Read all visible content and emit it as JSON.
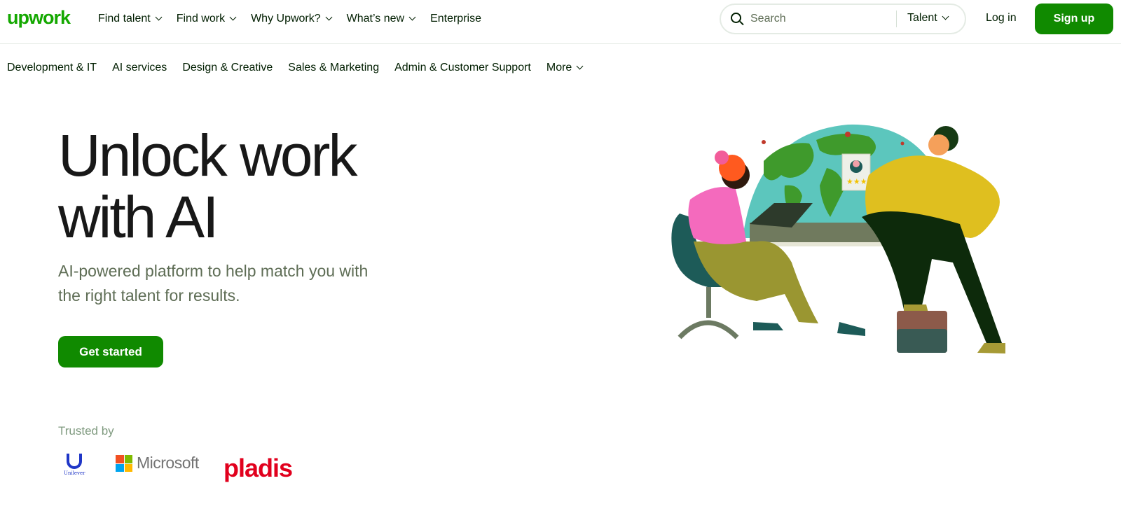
{
  "header": {
    "logo": "upwork",
    "nav": [
      {
        "label": "Find talent",
        "dropdown": true
      },
      {
        "label": "Find work",
        "dropdown": true
      },
      {
        "label": "Why Upwork?",
        "dropdown": true
      },
      {
        "label": "What’s new",
        "dropdown": true
      },
      {
        "label": "Enterprise",
        "dropdown": false
      }
    ],
    "search": {
      "placeholder": "Search",
      "scope": "Talent"
    },
    "login": "Log in",
    "signup": "Sign up"
  },
  "categories": [
    "Development & IT",
    "AI services",
    "Design & Creative",
    "Sales & Marketing",
    "Admin & Customer Support",
    "More"
  ],
  "hero": {
    "title_line1": "Unlock work",
    "title_line2": "with AI",
    "subtitle": "AI-powered platform to help match you with the right talent for results.",
    "cta": "Get started"
  },
  "trusted": {
    "label": "Trusted by",
    "logos": [
      {
        "name": "Unilever",
        "text": "Unilever"
      },
      {
        "name": "Microsoft",
        "text": "Microsoft"
      },
      {
        "name": "pladis",
        "text": "pladis"
      }
    ]
  },
  "colors": {
    "brand": "#14a800",
    "button": "#108a00",
    "muted": "#5e6d55"
  }
}
